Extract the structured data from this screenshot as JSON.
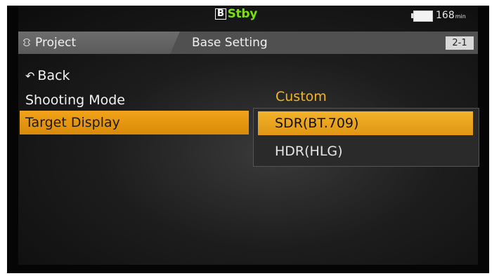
{
  "status": {
    "slot": "B",
    "rec_state": "Stby",
    "battery_time": "168",
    "battery_unit": "min"
  },
  "header": {
    "tab_project": "Project",
    "tab_base": "Base Setting",
    "page": "2-1"
  },
  "menu": {
    "back": "Back",
    "items": [
      {
        "label": "Shooting Mode",
        "value": "Custom"
      },
      {
        "label": "Target Display"
      }
    ]
  },
  "options": [
    "SDR(BT.709)",
    "HDR(HLG)"
  ],
  "colors": {
    "highlight": "#f1a31b",
    "value_text": "#f3b61d",
    "rec_status": "#78e400"
  }
}
